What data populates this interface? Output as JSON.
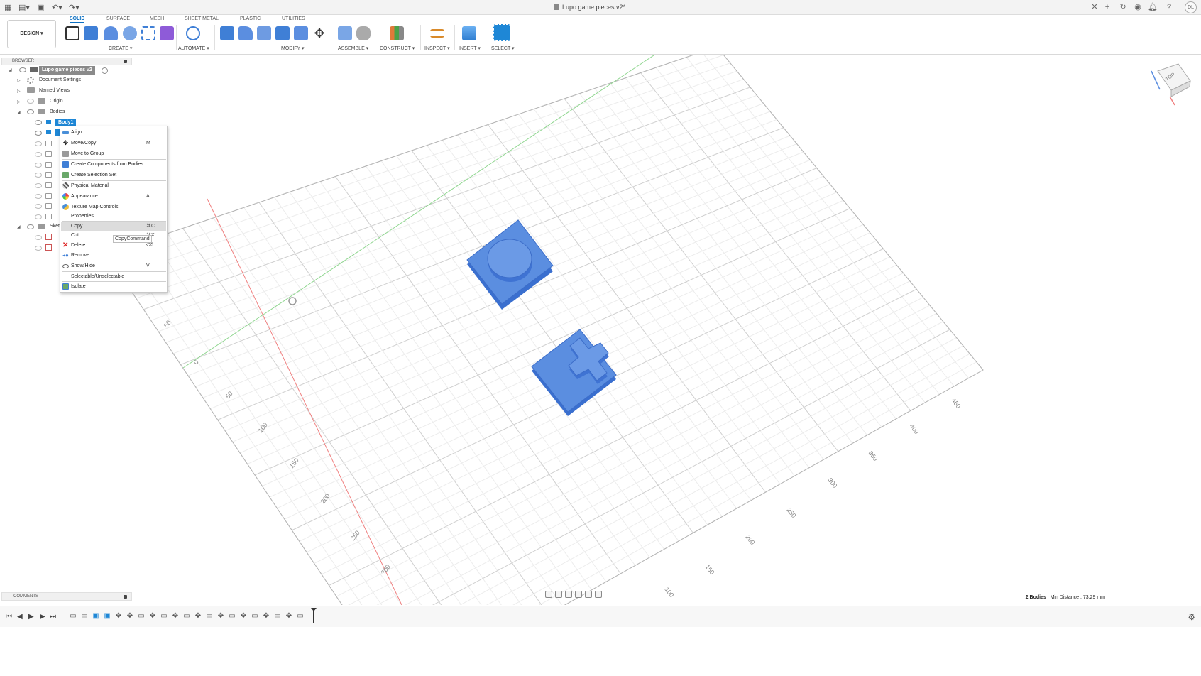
{
  "window": {
    "document_title": "Lupo game pieces v2*",
    "user_initials": "DL"
  },
  "ribbon": {
    "workspace": "DESIGN ▾",
    "tabs": [
      "SOLID",
      "SURFACE",
      "MESH",
      "SHEET METAL",
      "PLASTIC",
      "UTILITIES"
    ],
    "groups": [
      "CREATE ▾",
      "AUTOMATE ▾",
      "MODIFY ▾",
      "ASSEMBLE ▾",
      "CONSTRUCT ▾",
      "INSPECT ▾",
      "INSERT ▾",
      "SELECT ▾"
    ]
  },
  "browser": {
    "header": "BROWSER",
    "root": "Lupo game pieces v2",
    "items": {
      "document_settings": "Document Settings",
      "named_views": "Named Views",
      "origin": "Origin",
      "bodies": "Bodies",
      "body1": "Body1",
      "sketches": "Sket"
    }
  },
  "context_menu": {
    "items": [
      {
        "label": "Align",
        "shortcut": ""
      },
      {
        "label": "Move/Copy",
        "shortcut": "M"
      },
      {
        "label": "Move to Group",
        "shortcut": ""
      },
      {
        "label": "Create Components from Bodies",
        "shortcut": ""
      },
      {
        "label": "Create Selection Set",
        "shortcut": ""
      },
      {
        "label": "Physical Material",
        "shortcut": ""
      },
      {
        "label": "Appearance",
        "shortcut": "A"
      },
      {
        "label": "Texture Map Controls",
        "shortcut": ""
      },
      {
        "label": "Properties",
        "shortcut": ""
      },
      {
        "label": "Copy",
        "shortcut": "⌘C"
      },
      {
        "label": "Cut",
        "shortcut": "⌘X"
      },
      {
        "label": "Delete",
        "shortcut": "⌫"
      },
      {
        "label": "Remove",
        "shortcut": ""
      },
      {
        "label": "Show/Hide",
        "shortcut": "V"
      },
      {
        "label": "Selectable/Unselectable",
        "shortcut": ""
      },
      {
        "label": "Isolate",
        "shortcut": ""
      }
    ],
    "tooltip": "CopyCommand"
  },
  "viewport": {
    "viewcube_face": "TOP",
    "axis_labels_left": [
      "50",
      "0",
      "50",
      "100",
      "150",
      "200",
      "250",
      "300"
    ],
    "axis_labels_right": [
      "100",
      "150",
      "200",
      "250",
      "300",
      "350",
      "400",
      "450"
    ]
  },
  "comments": {
    "header": "COMMENTS"
  },
  "status": {
    "bodies": "2 Bodies",
    "min_distance": "Min Distance : 73.29 mm"
  },
  "colors": {
    "accent": "#0b6fc2",
    "body_blue": "#5b8ee0",
    "selection": "#1e87d6"
  }
}
